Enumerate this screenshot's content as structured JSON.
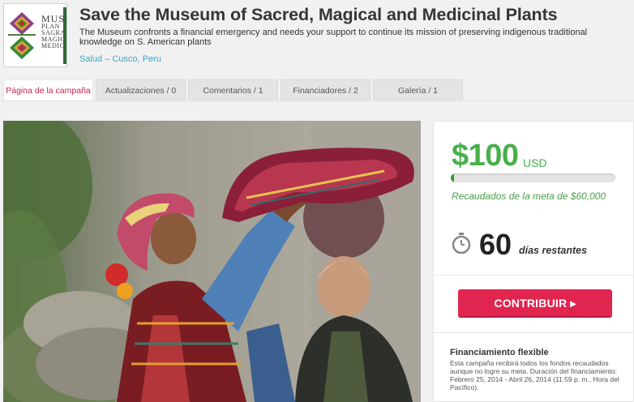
{
  "campaign": {
    "title": "Save the Museum of Sacred, Magical and Medicinal Plants",
    "description": "The Museum confronts a financial emergency and needs your support to continue its mission of preserving indigenous traditional knowledge on S. American plants",
    "category": "Salud",
    "location": "Cusco, Peru",
    "category_separator": " – "
  },
  "logo": {
    "lines": [
      "MUSE",
      "PLAN",
      "SAGRA",
      "MAGIC",
      "MEDICI"
    ]
  },
  "tabs": [
    {
      "label": "Página de la campaña",
      "active": true
    },
    {
      "label": "Actualizaciones / 0",
      "active": false
    },
    {
      "label": "Comentarios / 1",
      "active": false
    },
    {
      "label": "Financiadores / 2",
      "active": false
    },
    {
      "label": "Galería / 1",
      "active": false
    }
  ],
  "funding": {
    "amount": "$100",
    "currency": "USD",
    "progress_fraction": 0.0017,
    "goal_text": "Recaudados de la meta de $60,000",
    "days_left": "60",
    "days_label": "días restantes",
    "button_label": "CONTRIBUIR ▸",
    "flex_title": "Financiamiento flexible",
    "flex_body": "Esta campaña recibirá todos los fondos recaudados aunque no logre su meta. Duración del financiamiento: Febrero 25, 2014 - Abril 26, 2014 (11:59 p. m., Hora del Pacífico)."
  },
  "colors": {
    "accent_pink": "#e0254f",
    "accent_green": "#48b04a",
    "link_blue": "#3fa7c9"
  },
  "icons": {
    "timer": "stopwatch-icon"
  }
}
